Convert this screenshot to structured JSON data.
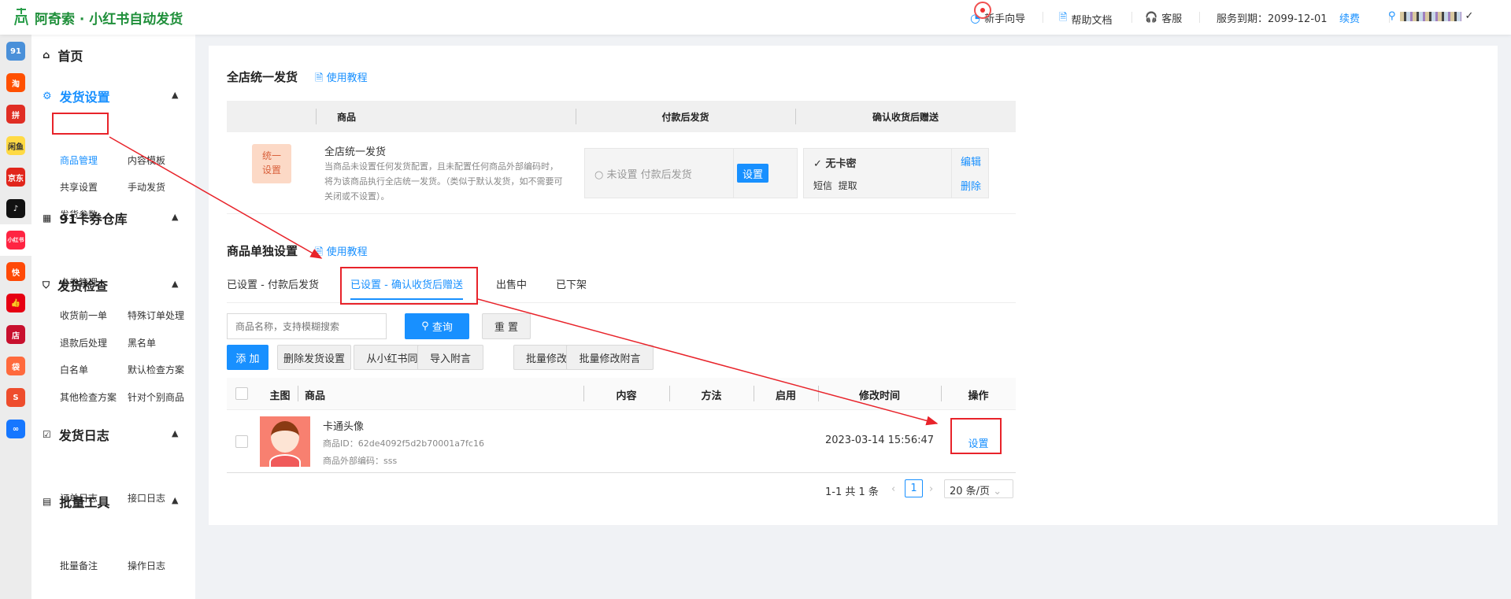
{
  "header": {
    "title": "阿奇索 · 小红书自动发货",
    "guide": "新手向导",
    "help": "帮助文档",
    "service": "客服",
    "expiry": "服务到期：2099-12-01",
    "renew": "续费"
  },
  "strip": [
    {
      "name": "91-logo",
      "label": "91",
      "color": "#4a90d9"
    },
    {
      "name": "taobao",
      "label": "淘",
      "color": "#ff5000"
    },
    {
      "name": "pinduoduo",
      "label": "拼",
      "color": "#e02e24"
    },
    {
      "name": "xianyu",
      "label": "闲鱼",
      "color": "#ffda44"
    },
    {
      "name": "jd",
      "label": "京东",
      "color": "#e1251b"
    },
    {
      "name": "douyin",
      "label": "♪",
      "color": "#111111"
    },
    {
      "name": "xiaohongshu",
      "label": "小红书",
      "color": "#ff2442"
    },
    {
      "name": "kuaishou",
      "label": "快",
      "color": "#ff4906"
    },
    {
      "name": "thumbs",
      "label": "👍",
      "color": "#e60012"
    },
    {
      "name": "dian",
      "label": "店",
      "color": "#c8102e"
    },
    {
      "name": "bag",
      "label": "袋",
      "color": "#ff6a3d"
    },
    {
      "name": "shopee",
      "label": "S",
      "color": "#ee4d2d"
    },
    {
      "name": "link",
      "label": "∞",
      "color": "#1677ff"
    }
  ],
  "menu": {
    "home": "首页",
    "delivery": "发货设置",
    "delivery_items": [
      "商品管理",
      "内容模板",
      "共享设置",
      "手动发货",
      "发货参数"
    ],
    "warehouse": "91卡券仓库",
    "warehouse_items": [
      "卡券管理"
    ],
    "check": "发货检查",
    "check_items": [
      "收货前一单",
      "特殊订单处理",
      "退款后处理",
      "黑名单",
      "白名单",
      "默认检查方案",
      "其他检查方案",
      "针对个别商品"
    ],
    "log": "发货日志",
    "log_items": [
      "订单日志",
      "接口日志"
    ],
    "batch": "批量工具",
    "batch_items": [
      "批量备注",
      "操作日志"
    ]
  },
  "global": {
    "title": "全店统一发货",
    "tutorial": "使用教程",
    "cols": [
      "商品",
      "付款后发货",
      "确认收货后赠送"
    ],
    "badge": "统一设置",
    "name": "全店统一发货",
    "desc": "当商品未设置任何发货配置，且未配置任何商品外部编码时，将为该商品执行全店统一发货。（类似于默认发货，如不需要可关闭或不设置）。",
    "pay_status": "未设置 付款后发货",
    "set": "设置",
    "gift_title": "无卡密",
    "gift_methods": "短信  提取",
    "edit": "编辑",
    "delete": "删除"
  },
  "single": {
    "title": "商品单独设置",
    "tutorial": "使用教程",
    "tabs": [
      "已设置 - 付款后发货",
      "已设置 - 确认收货后赠送",
      "出售中",
      "已下架"
    ],
    "search_placeholder": "商品名称，支持模糊搜索",
    "query": "查询",
    "reset": "重 置",
    "actions": [
      "添 加",
      "删除发货设置",
      "从小红书同步",
      "导入附言",
      "批量修改",
      "批量修改附言"
    ],
    "cols": [
      "主图",
      "商品",
      "内容",
      "方法",
      "启用",
      "修改时间",
      "操作"
    ],
    "rows": [
      {
        "name": "卡通头像",
        "id": "商品ID：62de4092f5d2b70001a7fc16",
        "code": "商品外部编码：sss",
        "time": "2023-03-14 15:56:47",
        "op": "设置"
      }
    ],
    "pagination": {
      "summary": "1-1 共 1 条",
      "page": "1",
      "size": "20 条/页"
    }
  }
}
